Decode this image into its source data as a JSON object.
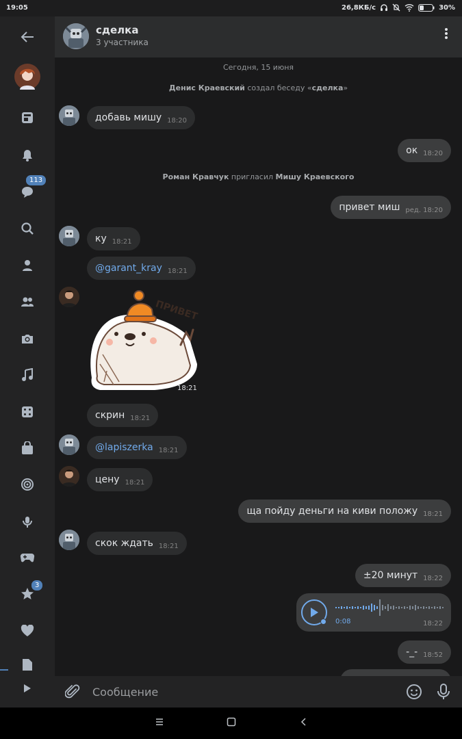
{
  "status_bar": {
    "time": "19:05",
    "speed": "26,8КБ/с",
    "battery": "30%"
  },
  "sidebar": {
    "messages_badge": "113",
    "favorites_badge": "3"
  },
  "header": {
    "title": "сделка",
    "subtitle": "3 участника"
  },
  "chat": {
    "date": "Сегодня, 15 июня",
    "system1": {
      "actor": "Денис Краевский",
      "action": " создал беседу «",
      "target": "сделка",
      "close": "»"
    },
    "system2": {
      "actor": "Роман Кравчук",
      "action": " пригласил ",
      "target": "Мишу Краевского"
    },
    "messages": [
      {
        "text": "добавь мишу",
        "time": "18:20"
      },
      {
        "text": "ок",
        "time": "18:20"
      },
      {
        "text": "привет миш",
        "time": "ред. 18:20"
      },
      {
        "text": "ку",
        "time": "18:21"
      },
      {
        "text": "@garant_kray",
        "time": "18:21"
      },
      {
        "text": "18:21"
      },
      {
        "text": "скрин",
        "time": "18:21"
      },
      {
        "text": "@lapiszerka",
        "time": "18:21"
      },
      {
        "text": "цену",
        "time": "18:21"
      },
      {
        "text": "ща пойду деньги на киви положу",
        "time": "18:21"
      },
      {
        "text": "скок ждать",
        "time": "18:21"
      },
      {
        "text": "±20 минут",
        "time": "18:22"
      },
      {
        "text": "-_-",
        "time": "18:52"
      }
    ],
    "sticker_text": "ПРИВЕТ",
    "voice": {
      "duration": "0:08",
      "time": "18:22"
    }
  },
  "composer": {
    "placeholder": "Сообщение"
  },
  "colors": {
    "accent": "#71aaeb",
    "badge": "#5181b8",
    "bubble": "#2c2d2e",
    "bubble_out": "#3c3d3e"
  }
}
